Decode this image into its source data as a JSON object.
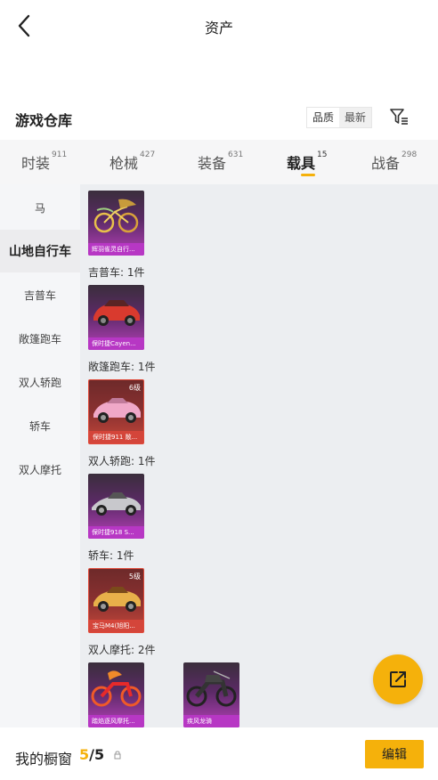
{
  "header": {
    "title": "资产",
    "back_icon": "chevron-left-icon"
  },
  "warehouse": {
    "title": "游戏仓库",
    "sort_options": [
      "品质",
      "最新"
    ]
  },
  "tabs": [
    {
      "label": "时装",
      "count": "911",
      "active": false
    },
    {
      "label": "枪械",
      "count": "427",
      "active": false
    },
    {
      "label": "装备",
      "count": "631",
      "active": false
    },
    {
      "label": "载具",
      "count": "15",
      "active": true
    },
    {
      "label": "战备",
      "count": "298",
      "active": false
    }
  ],
  "sidebar": {
    "items": [
      {
        "label": "马",
        "active": false
      },
      {
        "label": "山地自行车",
        "active": true
      },
      {
        "label": "吉普车",
        "active": false
      },
      {
        "label": "敞篷跑车",
        "active": false
      },
      {
        "label": "双人轿跑",
        "active": false
      },
      {
        "label": "轿车",
        "active": false
      },
      {
        "label": "双人摩托",
        "active": false
      }
    ]
  },
  "content": {
    "top_item": {
      "name": "辉羽雀灵自行...",
      "rarity": "purple"
    },
    "groups": [
      {
        "label": "吉普车: 1件",
        "items": [
          {
            "name": "保时捷Cayen...",
            "rarity": "purple",
            "level": ""
          }
        ]
      },
      {
        "label": "敞篷跑车: 1件",
        "items": [
          {
            "name": "保时捷911 敞...",
            "rarity": "red",
            "level": "6级"
          }
        ]
      },
      {
        "label": "双人轿跑: 1件",
        "items": [
          {
            "name": "保时捷918 S...",
            "rarity": "purple",
            "level": ""
          }
        ]
      },
      {
        "label": "轿车: 1件",
        "items": [
          {
            "name": "宝马M4(旭阳...",
            "rarity": "red",
            "level": "5级"
          }
        ]
      },
      {
        "label": "双人摩托: 2件",
        "items": [
          {
            "name": "踏焰逐风摩托...",
            "rarity": "purple",
            "level": ""
          },
          {
            "name": "疾风龙骑",
            "rarity": "purple",
            "level": ""
          }
        ]
      }
    ]
  },
  "bottom": {
    "label": "我的橱窗",
    "count_current": "5",
    "count_sep": "/",
    "count_total": "5",
    "edit_label": "编辑"
  },
  "colors": {
    "accent": "#f5b10b",
    "purple_card": "#b737c4",
    "red_card": "#d4453a"
  }
}
